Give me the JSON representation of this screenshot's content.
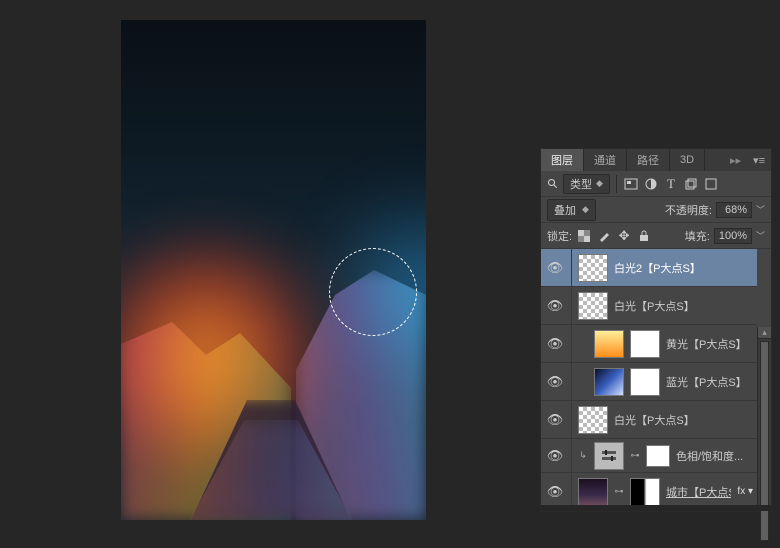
{
  "tabs": {
    "layers": "图层",
    "channels": "通道",
    "paths": "路径",
    "threeD": "3D"
  },
  "filter": {
    "kind": "类型"
  },
  "blend": {
    "mode": "叠加",
    "opacity_label": "不透明度:",
    "opacity_value": "68%"
  },
  "lock": {
    "label": "锁定:",
    "fill_label": "填充:",
    "fill_value": "100%"
  },
  "layers": [
    {
      "name": "白光2【P大点S】"
    },
    {
      "name": "白光【P大点S】"
    },
    {
      "name": "黄光【P大点S】"
    },
    {
      "name": "蓝光【P大点S】"
    },
    {
      "name": "白光【P大点S】"
    },
    {
      "name": "色相/饱和度..."
    },
    {
      "name": "城市【P大点S】"
    }
  ]
}
